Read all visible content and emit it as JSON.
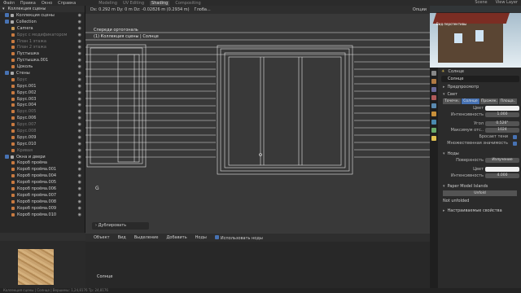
{
  "topbar": {
    "menus": [
      "Файл",
      "Правка",
      "Окно",
      "Справка"
    ],
    "workspaces": [
      "Modeling",
      "UV Editing",
      "Shading",
      "Compositing"
    ],
    "active_workspace": "Shading",
    "scene": "Scene",
    "view_layer": "View Layer"
  },
  "outliner": {
    "header": "Коллекция сцены",
    "rows": [
      {
        "label": "Коллекция сцены",
        "state": "normal",
        "color": "#aaaaaa"
      },
      {
        "label": "Collection",
        "state": "normal",
        "color": "#aaaaaa"
      },
      {
        "label": "Camera",
        "state": "normal",
        "color": "#c89a55"
      },
      {
        "label": "Брус с модификатором",
        "state": "dim",
        "color": "#c87a40"
      },
      {
        "label": "План 1 этажа",
        "state": "dim",
        "color": "#c87a40"
      },
      {
        "label": "План 2 этажа",
        "state": "dim",
        "color": "#c87a40"
      },
      {
        "label": "Пустышка",
        "state": "normal",
        "color": "#c87a40"
      },
      {
        "label": "Пустышка.001",
        "state": "normal",
        "color": "#c87a40"
      },
      {
        "label": "Цоколь",
        "state": "normal",
        "color": "#c87a40"
      },
      {
        "label": "Стены",
        "state": "normal",
        "color": "#aaaaaa"
      },
      {
        "label": "Брус",
        "state": "dim",
        "color": "#c87a40"
      },
      {
        "label": "Брус.001",
        "state": "normal",
        "color": "#c87a40"
      },
      {
        "label": "Брус.002",
        "state": "normal",
        "color": "#c87a40"
      },
      {
        "label": "Брус.003",
        "state": "normal",
        "color": "#c87a40"
      },
      {
        "label": "Брус.004",
        "state": "normal",
        "color": "#c87a40"
      },
      {
        "label": "Брус.005",
        "state": "dim",
        "color": "#c87a40"
      },
      {
        "label": "Брус.006",
        "state": "normal",
        "color": "#c87a40"
      },
      {
        "label": "Брус.007",
        "state": "dim",
        "color": "#c87a40"
      },
      {
        "label": "Брус.008",
        "state": "dim",
        "color": "#c87a40"
      },
      {
        "label": "Брус.009",
        "state": "normal",
        "color": "#c87a40"
      },
      {
        "label": "Брус.010",
        "state": "normal",
        "color": "#c87a40"
      },
      {
        "label": "Кривая",
        "state": "dim",
        "color": "#c87a40"
      },
      {
        "label": "Окна и двери",
        "state": "normal",
        "color": "#aaaaaa"
      },
      {
        "label": "Короб проёма",
        "state": "normal",
        "color": "#c87a40"
      },
      {
        "label": "Короб проёма.001",
        "state": "normal",
        "color": "#c87a40"
      },
      {
        "label": "Короб проёма.004",
        "state": "normal",
        "color": "#c87a40"
      },
      {
        "label": "Короб проёма.005",
        "state": "normal",
        "color": "#c87a40"
      },
      {
        "label": "Короб проёма.006",
        "state": "normal",
        "color": "#c87a40"
      },
      {
        "label": "Короб проёма.007",
        "state": "normal",
        "color": "#c87a40"
      },
      {
        "label": "Короб проёма.008",
        "state": "normal",
        "color": "#c87a40"
      },
      {
        "label": "Короб проёма.009",
        "state": "normal",
        "color": "#c87a40"
      },
      {
        "label": "Короб проёма.010",
        "state": "normal",
        "color": "#c87a40"
      }
    ]
  },
  "viewport": {
    "header_measure": "Dx: 0.292 m  Dy: 0 m  Dz: -0.02826 m (0.2934 m)",
    "global": "Глоба...",
    "options": "Опции",
    "view_name": "Спереди ортогональ",
    "collection": "(1) Коллекция сцены | Солнце",
    "operator": "Дублировать",
    "gizmo": "G"
  },
  "viewport2": {
    "mode": "Объект",
    "menus": [
      "Вид",
      "Выделение",
      "Добавить",
      "Ноды"
    ],
    "use_nodes": "Использовать ноды"
  },
  "bottom": {
    "label": "Солнце"
  },
  "mini_viewport": {
    "caption": "Вид перспективы",
    "sub": "(1) Коллекция сцены | Солнце"
  },
  "properties": {
    "top_name": "Солнце",
    "data_name": "Солнце",
    "sections": {
      "preview": "Предпросмотр",
      "light": "Свет",
      "nodes": "Ноды",
      "paper": "Paper Model Islands",
      "custom": "Настраиваемые свойства"
    },
    "light_types": [
      "Точечн.",
      "Солнце",
      "Прожек.",
      "Площа.."
    ],
    "active_light_type": "Солнце",
    "rows": {
      "color_label": "Цвет",
      "intensity_label": "Интенсивность",
      "intensity_value": "1.000",
      "angle_label": "Угол",
      "angle_value": "0.526°",
      "max_bounces_label": "Максимум отс..",
      "max_bounces_value": "1024",
      "cast_shadow": "Бросает тени",
      "multi_importance": "Множественная значимость",
      "surface_label": "Поверхность",
      "surface_value": "Излучение",
      "node_color_label": "Цвет",
      "node_intensity_label": "Интенсивность",
      "node_intensity_value": "4.000",
      "unfold": "Unfold",
      "not_unfolded": "Not unfolded"
    }
  },
  "status": {
    "text": "Коллекция сцены | Солнце | Вершины: 1,24,8176  Тр: 24,8176"
  },
  "colors": {
    "accent": "#4772b3",
    "wire": "#e8e8e8"
  }
}
